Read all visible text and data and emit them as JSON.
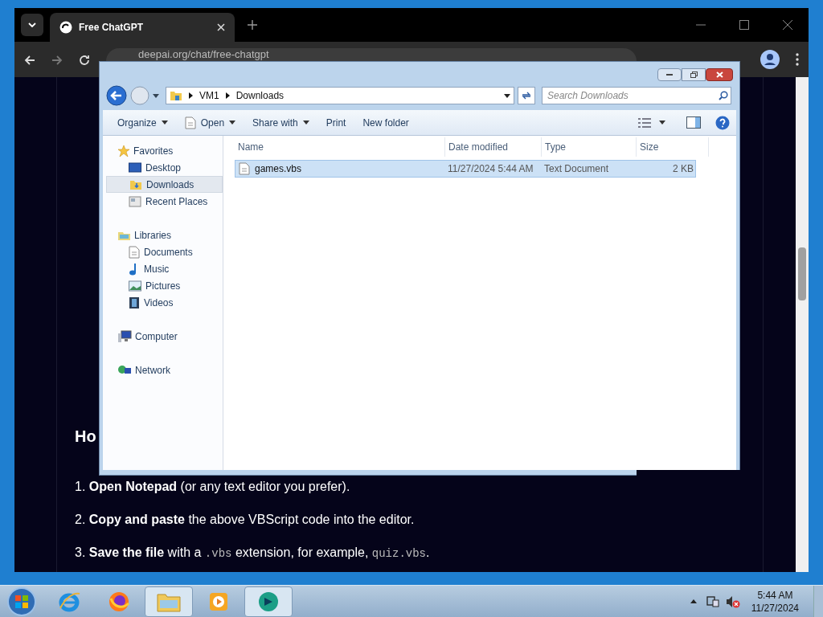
{
  "browser": {
    "tab": {
      "title": "Free ChatGPT",
      "selected": true
    },
    "url": "deepai.org/chat/free-chatgpt"
  },
  "page": {
    "heading": "Ho",
    "steps": [
      {
        "number": "1.",
        "parts": [
          {
            "kind": "bold",
            "text": "Open Notepad"
          },
          {
            "kind": "text",
            "text": " (or any text editor you prefer)."
          }
        ]
      },
      {
        "number": "2.",
        "parts": [
          {
            "kind": "bold",
            "text": "Copy and paste"
          },
          {
            "kind": "text",
            "text": " the above VBScript code into the editor."
          }
        ]
      },
      {
        "number": "3.",
        "parts": [
          {
            "kind": "bold",
            "text": "Save the file"
          },
          {
            "kind": "text",
            "text": " with a "
          },
          {
            "kind": "code",
            "text": ".vbs"
          },
          {
            "kind": "text",
            "text": " extension, for example, "
          },
          {
            "kind": "code",
            "text": "quiz.vbs"
          },
          {
            "kind": "text",
            "text": "."
          }
        ]
      }
    ]
  },
  "explorer": {
    "path": [
      "VM1",
      "Downloads"
    ],
    "search": {
      "placeholder": "Search Downloads"
    },
    "toolbar": [
      {
        "label": "Organize",
        "menu": true
      },
      {
        "label": "Open",
        "menu": true
      },
      {
        "label": "Share with",
        "menu": true
      },
      {
        "label": "Print",
        "menu": false
      },
      {
        "label": "New folder",
        "menu": false
      }
    ],
    "nav": [
      {
        "label": "Favorites",
        "kind": "star",
        "children": [
          {
            "label": "Desktop",
            "kind": "desktop",
            "selected": false
          },
          {
            "label": "Downloads",
            "kind": "downloads",
            "selected": true
          },
          {
            "label": "Recent Places",
            "kind": "recent",
            "selected": false
          }
        ]
      },
      {
        "label": "Libraries",
        "kind": "libraries",
        "children": [
          {
            "label": "Documents",
            "kind": "doc",
            "selected": false
          },
          {
            "label": "Music",
            "kind": "music",
            "selected": false
          },
          {
            "label": "Pictures",
            "kind": "pictures",
            "selected": false
          },
          {
            "label": "Videos",
            "kind": "videos",
            "selected": false
          }
        ]
      },
      {
        "label": "Computer",
        "kind": "computer"
      },
      {
        "label": "Network",
        "kind": "network"
      }
    ],
    "columns": [
      "Name",
      "Date modified",
      "Type",
      "Size"
    ],
    "files": [
      {
        "name": "games.vbs",
        "date": "11/27/2024 5:44 AM",
        "type": "Text Document",
        "size": "2 KB",
        "selected": true
      }
    ]
  },
  "taskbar": {
    "apps": [
      {
        "kind": "ie",
        "active": false
      },
      {
        "kind": "firefox",
        "active": false
      },
      {
        "kind": "folder",
        "active": true
      },
      {
        "kind": "media",
        "active": false
      },
      {
        "kind": "chat",
        "active": true
      }
    ],
    "clock": {
      "time": "5:44 AM",
      "date": "11/27/2024"
    }
  }
}
